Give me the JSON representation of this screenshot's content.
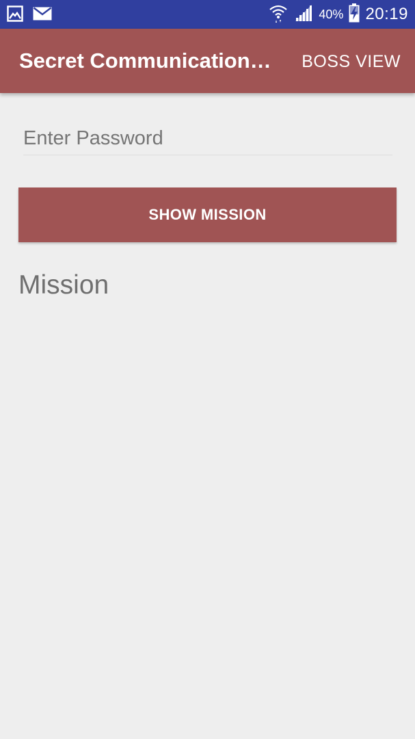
{
  "status_bar": {
    "battery_percent": "40%",
    "time": "20:19",
    "icons": {
      "left": [
        "image-icon",
        "mail-icon"
      ],
      "right": [
        "wifi-icon",
        "signal-icon",
        "battery-charging-icon"
      ]
    }
  },
  "app_bar": {
    "title": "Secret Communication…",
    "action_label": "BOSS VIEW"
  },
  "form": {
    "password_placeholder": "Enter Password",
    "password_value": "",
    "button_label": "SHOW MISSION"
  },
  "mission": {
    "text": "Mission"
  },
  "colors": {
    "status_bar": "#303f9f",
    "primary": "#a05454",
    "background": "#eeeeee",
    "hint_text": "#757575",
    "mission_text": "#6f6f6f"
  }
}
